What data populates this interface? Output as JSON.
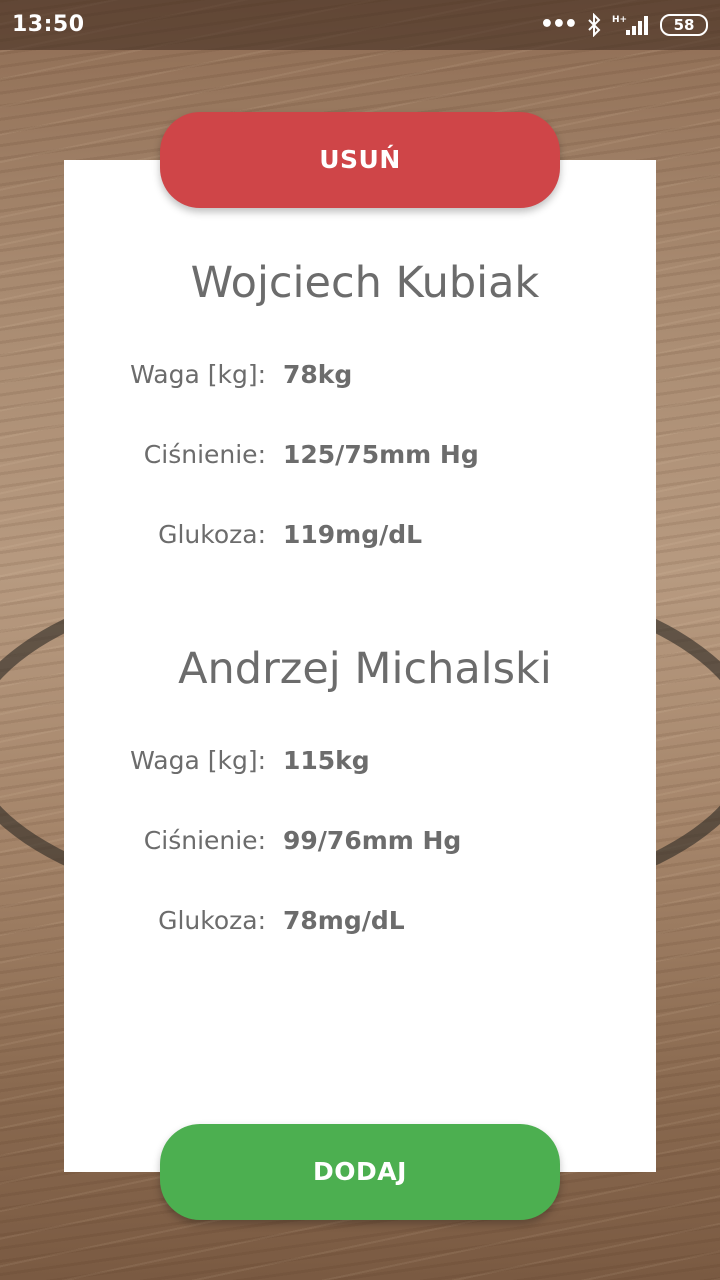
{
  "status_bar": {
    "time": "13:50",
    "battery": "58",
    "network_label": "H+"
  },
  "actions": {
    "delete_label": "USUŃ",
    "add_label": "DODAJ"
  },
  "patients": [
    {
      "name": "Wojciech Kubiak",
      "rows": [
        {
          "label": "Waga [kg]:",
          "value": "78kg"
        },
        {
          "label": "Ciśnienie:",
          "value": "125/75mm Hg"
        },
        {
          "label": "Glukoza:",
          "value": "119mg/dL"
        }
      ]
    },
    {
      "name": "Andrzej Michalski",
      "rows": [
        {
          "label": "Waga [kg]:",
          "value": "115kg"
        },
        {
          "label": "Ciśnienie:",
          "value": "99/76mm Hg"
        },
        {
          "label": "Glukoza:",
          "value": "78mg/dL"
        }
      ]
    }
  ],
  "colors": {
    "delete": "#cf4548",
    "add": "#4caf50",
    "text": "#6c6c6c",
    "card": "#ffffff"
  },
  "icons": [
    "more-dots-icon",
    "bluetooth-icon",
    "signal-icon",
    "battery-icon"
  ]
}
